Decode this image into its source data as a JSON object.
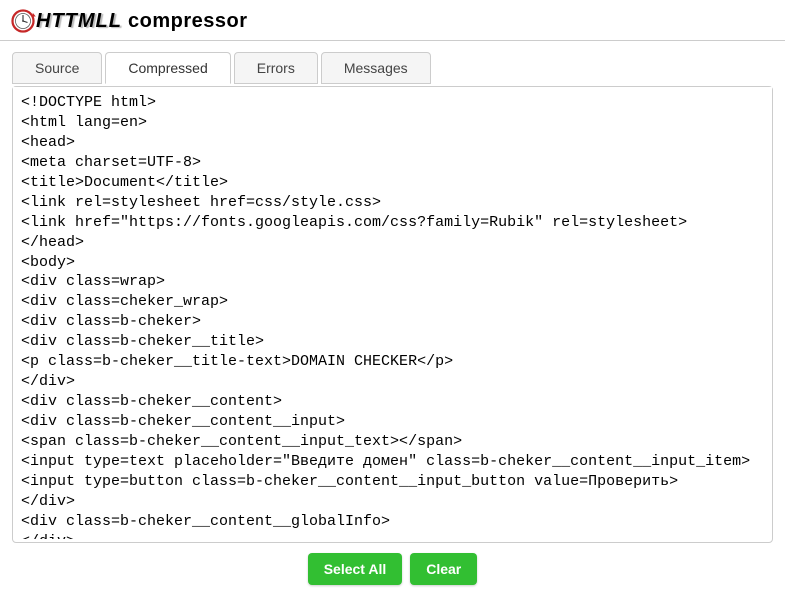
{
  "header": {
    "brand_html_part": "HTTMLL",
    "brand_suffix": " compressor"
  },
  "tabs": [
    {
      "label": "Source",
      "active": false
    },
    {
      "label": "Compressed",
      "active": true
    },
    {
      "label": "Errors",
      "active": false
    },
    {
      "label": "Messages",
      "active": false
    }
  ],
  "buttons": {
    "select_all": "Select All",
    "clear": "Clear"
  },
  "output_code": "<!DOCTYPE html>\n<html lang=en>\n<head>\n<meta charset=UTF-8>\n<title>Document</title>\n<link rel=stylesheet href=css/style.css>\n<link href=\"https://fonts.googleapis.com/css?family=Rubik\" rel=stylesheet>\n</head>\n<body>\n<div class=wrap>\n<div class=cheker_wrap>\n<div class=b-cheker>\n<div class=b-cheker__title>\n<p class=b-cheker__title-text>DOMAIN CHECKER</p>\n</div>\n<div class=b-cheker__content>\n<div class=b-cheker__content__input>\n<span class=b-cheker__content__input_text></span>\n<input type=text placeholder=\"Введите домен\" class=b-cheker__content__input_item>\n<input type=button class=b-cheker__content__input_button value=Проверить>\n</div>\n<div class=b-cheker__content__globalInfo>\n</div>\n</div>\n</div>\n</div>\n</div>\n</body>\n</html>"
}
